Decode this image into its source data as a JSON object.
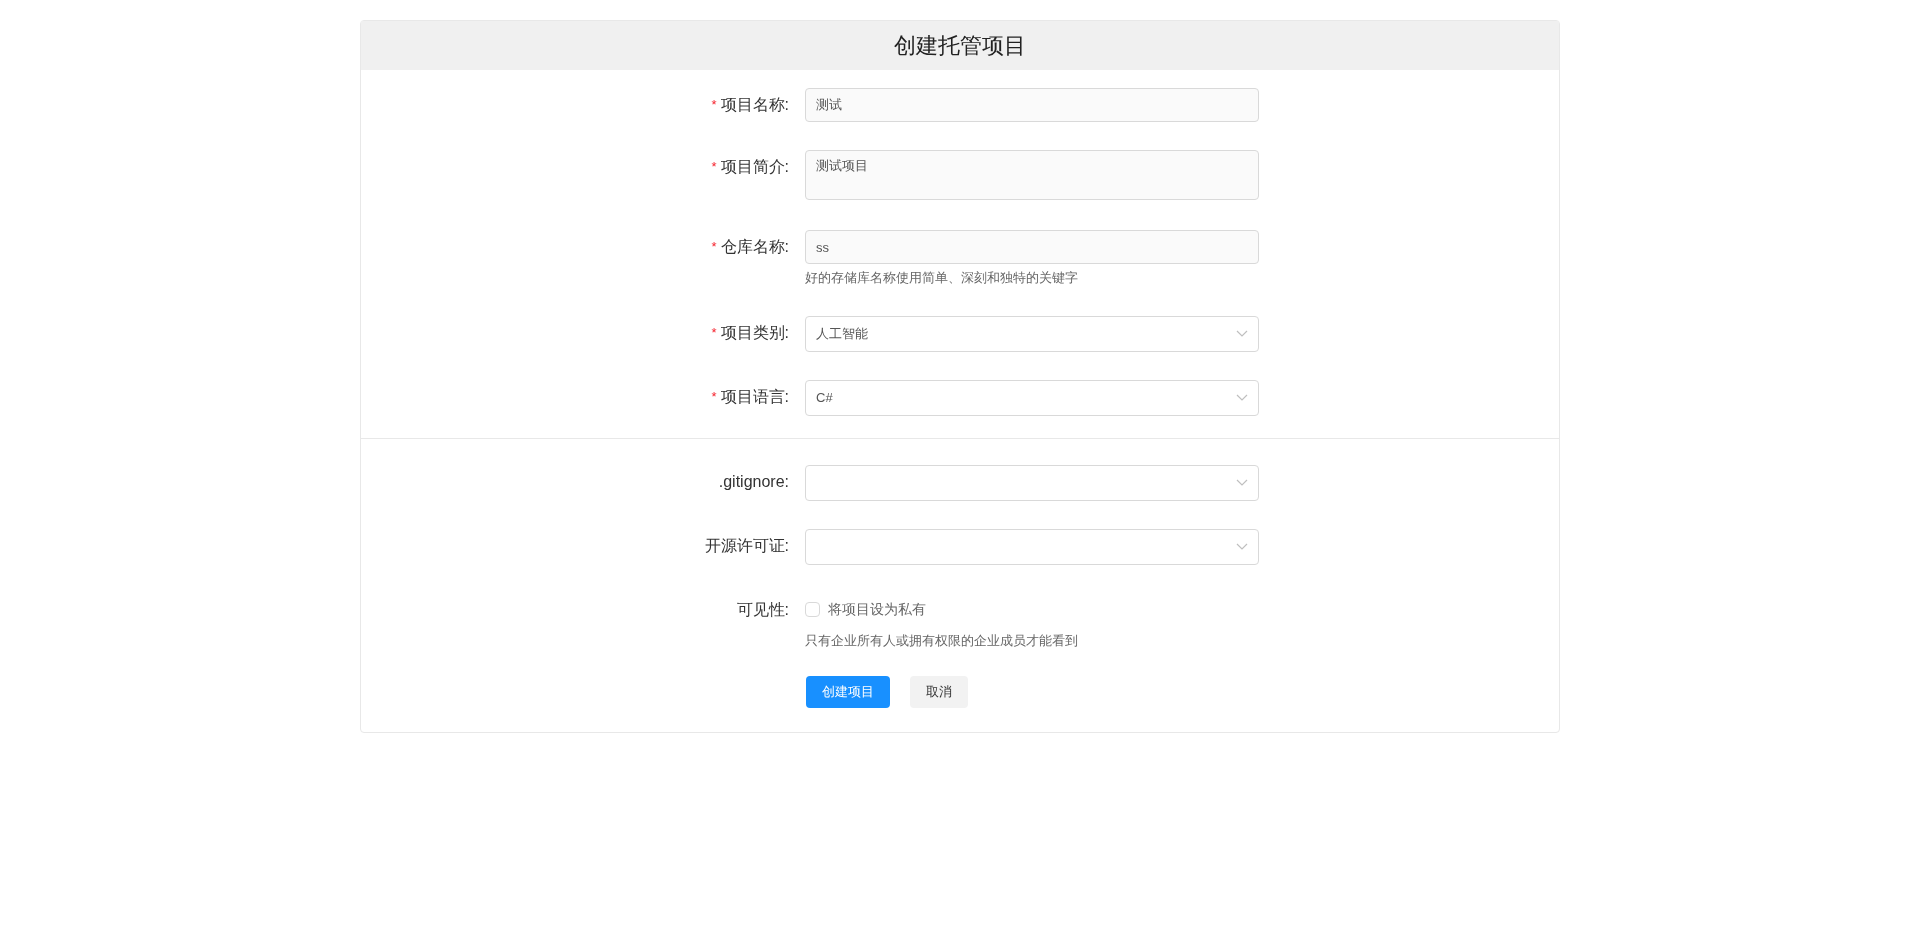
{
  "title": "创建托管项目",
  "sections": [
    {
      "fields": [
        {
          "kind": "input",
          "label": "项目名称:",
          "required_mark": "*",
          "value": "测试"
        },
        {
          "kind": "textarea",
          "label": "项目简介:",
          "required_mark": "*",
          "value": "测试项目"
        },
        {
          "kind": "input",
          "label": "仓库名称:",
          "required_mark": "*",
          "value": "ss",
          "hint": "好的存储库名称使用简单、深刻和独特的关键字"
        },
        {
          "kind": "select",
          "label": "项目类别:",
          "required_mark": "*",
          "value": "人工智能"
        },
        {
          "kind": "select",
          "label": "项目语言:",
          "required_mark": "*",
          "value": "C#"
        }
      ]
    },
    {
      "fields": [
        {
          "kind": "select",
          "label": ".gitignore:"
        },
        {
          "kind": "select",
          "label": "开源许可证:"
        },
        {
          "kind": "checkbox",
          "label": "可见性:",
          "option": "将项目设为私有",
          "checked": false,
          "hint": "只有企业所有人或拥有权限的企业成员才能看到"
        }
      ]
    }
  ],
  "buttons": [
    {
      "kind": "primary",
      "label": "创建项目"
    },
    {
      "kind": "secondary",
      "label": "取消"
    }
  ]
}
